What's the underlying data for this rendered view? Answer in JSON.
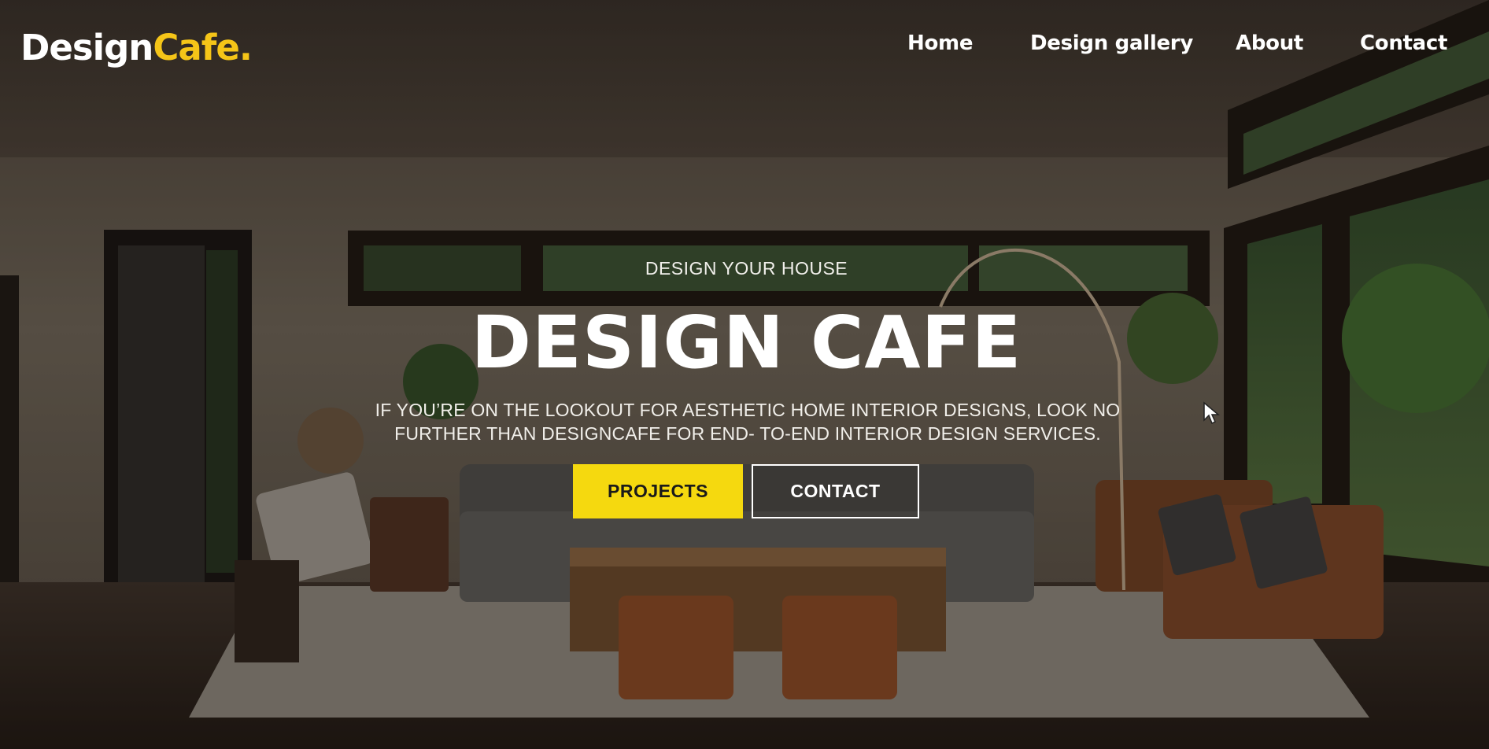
{
  "brand": {
    "name_part1": "Design",
    "name_part2": "Cafe.",
    "accent_color": "#f5c518"
  },
  "nav": {
    "items": [
      {
        "label": "Home"
      },
      {
        "label": "Design gallery"
      },
      {
        "label": "About"
      },
      {
        "label": "Contact"
      }
    ]
  },
  "hero": {
    "eyebrow": "DESIGN YOUR HOUSE",
    "title": "DESIGN CAFE",
    "description": "IF YOU’RE ON THE LOOKOUT FOR AESTHETIC HOME INTERIOR DESIGNS, LOOK NO FURTHER THAN DESIGNCAFE FOR END- TO-END INTERIOR DESIGN SERVICES.",
    "background": "living-room-photo",
    "buttons": {
      "projects_label": "PROJECTS",
      "projects_color": "#f5d90f",
      "contact_label": "CONTACT"
    }
  },
  "icons": {
    "cursor": "mouse-pointer-icon"
  }
}
